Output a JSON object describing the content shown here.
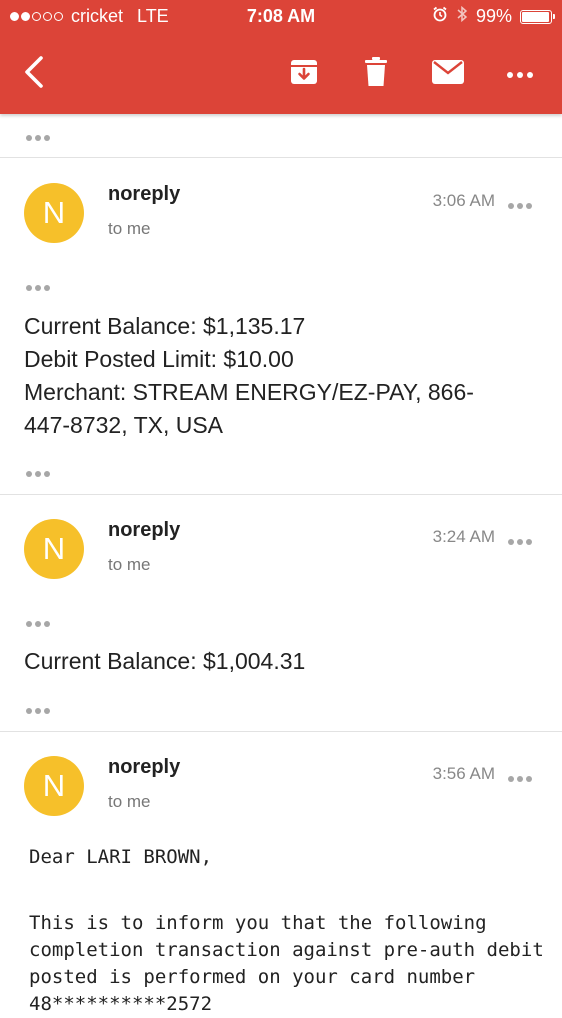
{
  "status_bar": {
    "carrier": "cricket",
    "network": "LTE",
    "time": "7:08 AM",
    "battery": "99%",
    "battery_level": 0.99,
    "signal_bars": 2
  },
  "toolbar": {
    "back_icon": "chevron-left-icon",
    "archive_icon": "archive-icon",
    "delete_icon": "trash-icon",
    "mark_icon": "mail-icon",
    "more_icon": "more-horizontal-icon"
  },
  "messages": [
    {
      "avatar_letter": "N",
      "sender": "noreply",
      "recipient": "to me",
      "time": "3:06 AM",
      "body": [
        "Current Balance: $1,135.17",
        "Debit Posted Limit: $10.00",
        "Merchant: STREAM ENERGY/EZ-PAY, 866-",
        "447-8732, TX, USA"
      ]
    },
    {
      "avatar_letter": "N",
      "sender": "noreply",
      "recipient": "to me",
      "time": "3:24 AM",
      "body": [
        "Current Balance: $1,004.31"
      ]
    },
    {
      "avatar_letter": "N",
      "sender": "noreply",
      "recipient": "to me",
      "time": "3:56 AM",
      "body": [
        "Dear LARI BROWN,",
        "",
        "This is to inform you that the following",
        "completion transaction against pre-auth debit",
        "posted is performed on your card number",
        "48**********2572"
      ]
    }
  ],
  "colors": {
    "header": "#dc4438",
    "avatar": "#f6c02a"
  }
}
